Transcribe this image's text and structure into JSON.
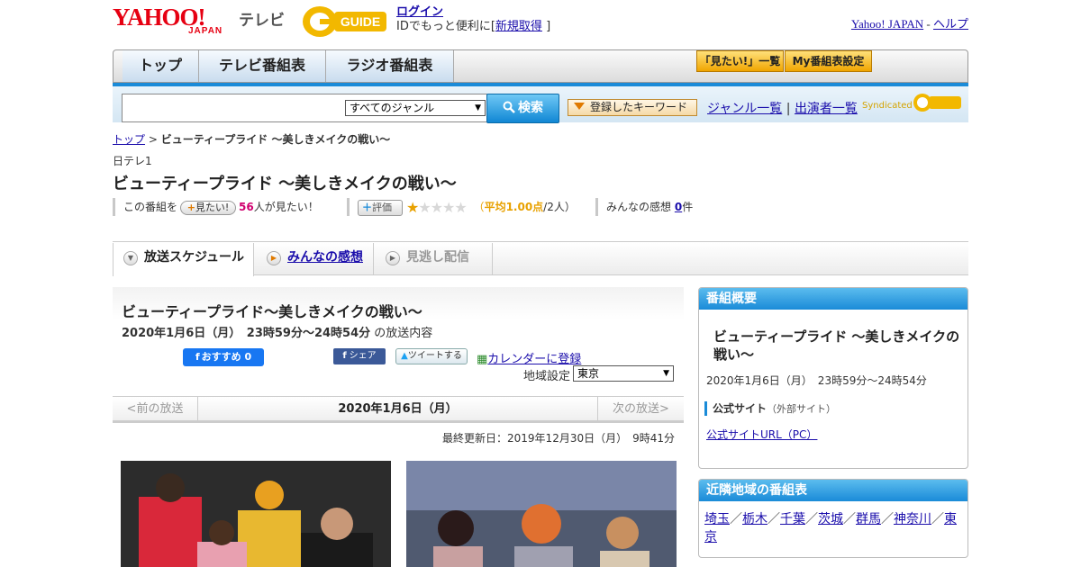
{
  "header": {
    "yahoo_logo": "YAHOO!",
    "japan_logo": "JAPAN",
    "tv_label": "テレビ",
    "gguide_logo": "G-GUIDE",
    "login": "ログイン",
    "login_prompt": "IDでもっと便利に[",
    "register": "新規取得",
    "login_prompt_end": "]",
    "yahoo_japan_link": "Yahoo! JAPAN",
    "separator": " - ",
    "help_link": "ヘルプ"
  },
  "nav": {
    "tabs": [
      "トップ",
      "テレビ番組表",
      "ラジオ番組表"
    ],
    "mitai_list": "「見たい!」一覧",
    "my_schedule": "My番組表設定"
  },
  "search": {
    "genre": "すべてのジャンル",
    "search_button": "検索",
    "keyword_button": "登録したキーワード",
    "genre_list": "ジャンル一覧",
    "pipe": "|",
    "performer_list": "出演者一覧",
    "syndicated": "Syndicated"
  },
  "breadcrumb": {
    "top": "トップ",
    "sep": " > ",
    "current": "ビューティープライド ～美しきメイクの戦い～"
  },
  "program": {
    "channel": "日テレ1",
    "title": "ビューティープライド ～美しきメイクの戦い～",
    "kono_bangumi": "この番組を",
    "mitai_button": "見たい!",
    "mitai_count": "56",
    "mitai_suffix": "人が見たい！",
    "rate_button": "評価",
    "rating_label": "平均1.00点",
    "rating_suffix": "/2人）",
    "rating_prefix": "（",
    "stars_on": 1,
    "stars_total": 5,
    "kansou_label": "みんなの感想",
    "kansou_count": "0",
    "kansou_suffix": "件"
  },
  "tabs": {
    "schedule": "放送スケジュール",
    "kansou": "みんなの感想",
    "minogashi": "見逃し配信"
  },
  "broadcast": {
    "title": "ビューティープライド～美しきメイクの戦い～",
    "date": "2020年1月6日（月）　23時59分～24時54分",
    "date_suffix": "の放送内容",
    "fb_button": "おすすめ 0",
    "share_button": "シェア",
    "tweet_button": "ツイートする",
    "calendar": "カレンダーに登録",
    "region_label": "地域設定",
    "region_value": "東京",
    "prev": "<前の放送",
    "current_date": "2020年1月6日（月）",
    "next": "次の放送>",
    "updated": "最終更新日：2019年12月30日（月）　9時41分"
  },
  "sidebar": {
    "overview_head": "番組概要",
    "overview_title": "ビューティープライド ～美しきメイクの戦い～",
    "overview_date": "2020年1月6日（月）　23時59分～24時54分",
    "official_site": "公式サイト",
    "official_note": "（外部サイト）",
    "official_link": "公式サイトURL（PC）",
    "nearby_head": "近隣地域の番組表",
    "regions": [
      "埼玉",
      "栃木",
      "千葉",
      "茨城",
      "群馬",
      "神奈川",
      "東京"
    ],
    "region_sep": "／"
  },
  "colors": {
    "accent_blue": "#1a8bd8",
    "yahoo_red": "#e60012",
    "star_orange": "#e8a100",
    "pink": "#d0006f"
  }
}
